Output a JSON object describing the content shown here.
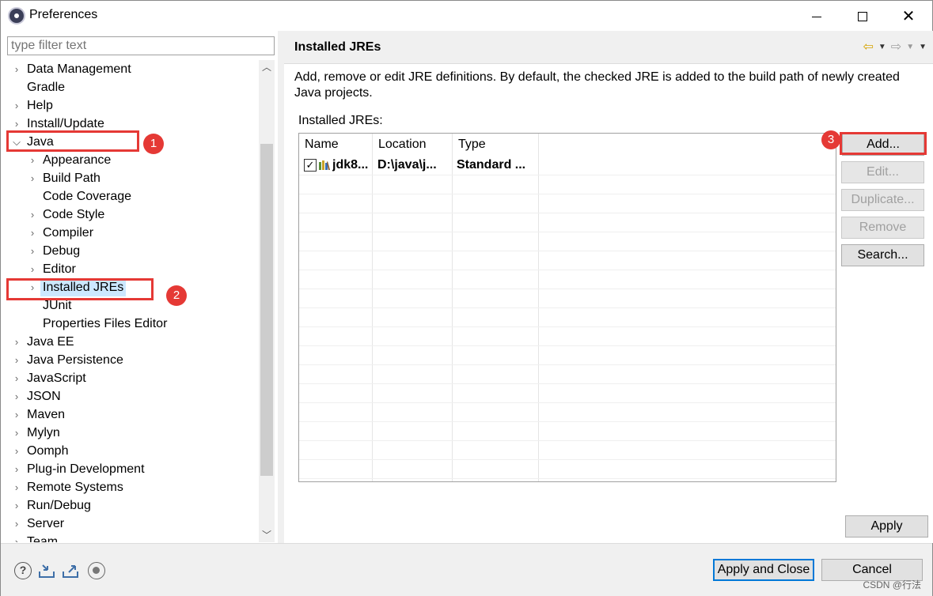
{
  "window": {
    "title": "Preferences",
    "icon": "eclipse-icon"
  },
  "sidebar": {
    "filter_placeholder": "type filter text",
    "items": [
      {
        "label": "Data Management",
        "level": 0,
        "expander": "collapsed"
      },
      {
        "label": "Gradle",
        "level": 0,
        "expander": "none"
      },
      {
        "label": "Help",
        "level": 0,
        "expander": "collapsed"
      },
      {
        "label": "Install/Update",
        "level": 0,
        "expander": "collapsed"
      },
      {
        "label": "Java",
        "level": 0,
        "expander": "expanded"
      },
      {
        "label": "Appearance",
        "level": 1,
        "expander": "collapsed"
      },
      {
        "label": "Build Path",
        "level": 1,
        "expander": "collapsed"
      },
      {
        "label": "Code Coverage",
        "level": 1,
        "expander": "none"
      },
      {
        "label": "Code Style",
        "level": 1,
        "expander": "collapsed"
      },
      {
        "label": "Compiler",
        "level": 1,
        "expander": "collapsed"
      },
      {
        "label": "Debug",
        "level": 1,
        "expander": "collapsed"
      },
      {
        "label": "Editor",
        "level": 1,
        "expander": "collapsed"
      },
      {
        "label": "Installed JREs",
        "level": 1,
        "expander": "collapsed",
        "selected": true
      },
      {
        "label": "JUnit",
        "level": 1,
        "expander": "none"
      },
      {
        "label": "Properties Files Editor",
        "level": 1,
        "expander": "none"
      },
      {
        "label": "Java EE",
        "level": 0,
        "expander": "collapsed"
      },
      {
        "label": "Java Persistence",
        "level": 0,
        "expander": "collapsed"
      },
      {
        "label": "JavaScript",
        "level": 0,
        "expander": "collapsed"
      },
      {
        "label": "JSON",
        "level": 0,
        "expander": "collapsed"
      },
      {
        "label": "Maven",
        "level": 0,
        "expander": "collapsed"
      },
      {
        "label": "Mylyn",
        "level": 0,
        "expander": "collapsed"
      },
      {
        "label": "Oomph",
        "level": 0,
        "expander": "collapsed"
      },
      {
        "label": "Plug-in Development",
        "level": 0,
        "expander": "collapsed"
      },
      {
        "label": "Remote Systems",
        "level": 0,
        "expander": "collapsed"
      },
      {
        "label": "Run/Debug",
        "level": 0,
        "expander": "collapsed"
      },
      {
        "label": "Server",
        "level": 0,
        "expander": "collapsed"
      },
      {
        "label": "Team",
        "level": 0,
        "expander": "collapsed"
      }
    ]
  },
  "page": {
    "title": "Installed JREs",
    "description": "Add, remove or edit JRE definitions. By default, the checked JRE is added to the build path of newly created Java projects.",
    "list_label": "Installed JREs:",
    "table": {
      "columns": [
        "Name",
        "Location",
        "Type"
      ],
      "rows": [
        {
          "checked": true,
          "name": "jdk8...",
          "location": "D:\\java\\j...",
          "type": "Standard ..."
        }
      ]
    },
    "buttons": {
      "add": "Add...",
      "edit": "Edit...",
      "duplicate": "Duplicate...",
      "remove": "Remove",
      "search": "Search...",
      "apply": "Apply"
    }
  },
  "footer": {
    "apply_close": "Apply and Close",
    "cancel": "Cancel",
    "icons": [
      "help-icon",
      "import-icon",
      "export-icon",
      "record-icon"
    ],
    "watermark": "CSDN @行法"
  },
  "annotations": [
    "1",
    "2",
    "3"
  ],
  "colors": {
    "annotation": "#e53935",
    "selection": "#cce8ff",
    "default_button_border": "#0078d7"
  }
}
